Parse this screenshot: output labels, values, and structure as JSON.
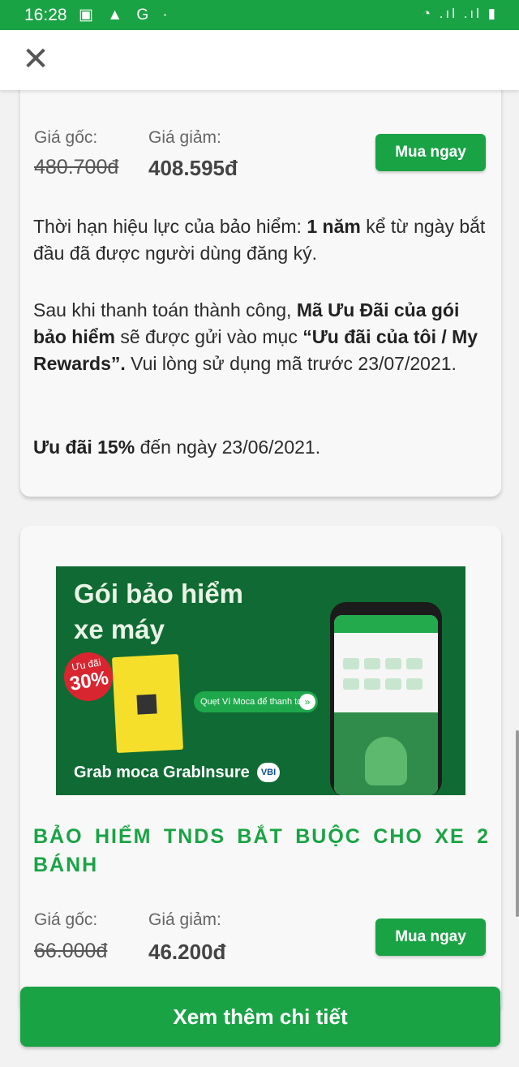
{
  "status_bar": {
    "time": "16:28",
    "left_icons": "▣ ▲ G ·",
    "right_icons": "◔ .ıl .ıl ▮"
  },
  "close_glyph": "✕",
  "card1": {
    "label_original": "Giá gốc:",
    "label_discount": "Giá giảm:",
    "price_original": "480.700đ",
    "price_discount": "408.595đ",
    "buy_label": "Mua ngay",
    "p1_a": "Thời hạn hiệu lực của bảo hiểm: ",
    "p1_b": "1 năm",
    "p1_c": " kể từ ngày bắt đầu đã được người dùng đăng ký.",
    "p2_a": "Sau khi thanh toán thành công, ",
    "p2_b": "Mã Ưu Đãi của gói bảo hiểm",
    "p2_c": "  sẽ được gửi vào mục ",
    "p2_d": "“Ưu đãi của tôi / My Rewards”.",
    "p2_e": " Vui lòng sử dụng mã trước 23/07/2021.",
    "p3_a": "Ưu đãi 15%",
    "p3_b": " đến ngày 23/06/2021."
  },
  "banner": {
    "title_line1": "Gói bảo hiểm",
    "title_line2": "xe máy",
    "badge_top": "Ưu đãi",
    "badge_value": "30%",
    "pill_text": "Quẹt Ví Moca để thanh toán",
    "pill_arrow": "»",
    "footer_brands": "Grab moca  GrabInsure",
    "vbi": "VBI"
  },
  "card2": {
    "title": "BẢO HIỂM TNDS BẮT BUỘC CHO XE 2 BÁNH",
    "label_original": "Giá gốc:",
    "label_discount": "Giá giảm:",
    "price_original": "66.000đ",
    "price_discount": "46.200đ",
    "buy_label": "Mua ngay"
  },
  "bottom_button": "Xem thêm chi tiết",
  "colors": {
    "brand_green": "#19a345",
    "card_bg": "#f7f8f7"
  }
}
